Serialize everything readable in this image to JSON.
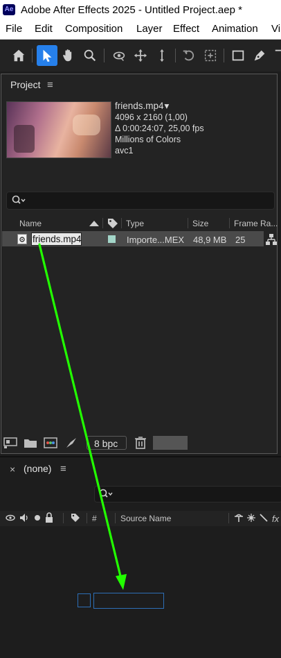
{
  "window": {
    "app_badge": "Ae",
    "title": "Adobe After Effects 2025 - Untitled Project.aep *"
  },
  "menu": {
    "items": [
      "File",
      "Edit",
      "Composition",
      "Layer",
      "Effect",
      "Animation",
      "Vi"
    ]
  },
  "toolbar": {
    "tools": [
      "home-icon",
      "selection-tool-icon",
      "hand-tool-icon",
      "zoom-tool-icon",
      "orbit-camera-icon",
      "pan-camera-icon",
      "dolly-camera-icon",
      "rotation-tool-icon",
      "pan-behind-icon",
      "rectangle-tool-icon",
      "pen-tool-icon"
    ],
    "selected": "selection-tool-icon",
    "accent": "#2680eb"
  },
  "project": {
    "tab_label": "Project",
    "menu_glyph": "≡",
    "preview": {
      "filename": "friends.mp4",
      "dropdown_glyph": "▾",
      "resolution": "4096 x 2160 (1,00)",
      "duration": "Δ 0:00:24:07, 25,00 fps",
      "colors": "Millions of Colors",
      "codec": "avc1"
    },
    "search": {
      "placeholder": ""
    },
    "columns": {
      "name": "Name",
      "type": "Type",
      "size": "Size",
      "frame_rate": "Frame Ra..."
    },
    "rows": [
      {
        "name": "friends.mp4",
        "label_color": "#a3d5c8",
        "type": "Importe...MEX",
        "size": "48,9 MB",
        "frame_rate": "25"
      }
    ],
    "bit_depth": "8 bpc"
  },
  "timeline": {
    "close_glyph": "×",
    "tab_label": "(none)",
    "menu_glyph": "≡",
    "columns": {
      "number": "#",
      "source_name": "Source Name"
    }
  },
  "drag_arrow_color": "#22ff00"
}
